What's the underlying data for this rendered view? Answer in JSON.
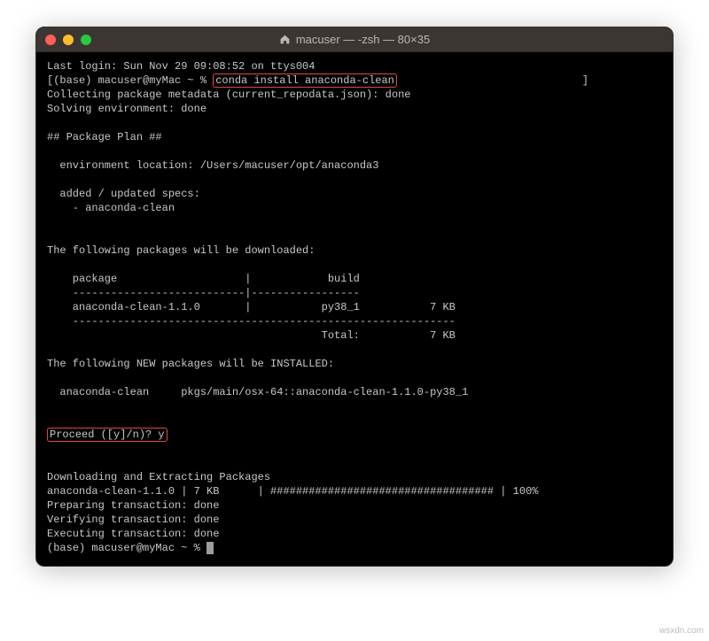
{
  "titlebar": {
    "title": "macuser — -zsh — 80×35"
  },
  "term": {
    "line_login": "Last login: Sun Nov 29 09:08:52 on ttys004",
    "prompt1_pre": "[(base) macuser@myMac ~ % ",
    "prompt1_cmd": "conda install anaconda-clean",
    "collecting": "Collecting package metadata (current_repodata.json): done",
    "solving": "Solving environment: done",
    "plan_hdr": "## Package Plan ##",
    "env_loc": "  environment location: /Users/macuser/opt/anaconda3",
    "added_specs": "  added / updated specs:",
    "spec_item": "    - anaconda-clean",
    "dl_hdr": "The following packages will be downloaded:",
    "tbl_hdr": "    package                    |            build",
    "tbl_sep1": "    ---------------------------|-----------------",
    "tbl_row": "    anaconda-clean-1.1.0       |           py38_1           7 KB",
    "tbl_sep2": "    ------------------------------------------------------------",
    "tbl_total": "                                           Total:           7 KB",
    "new_hdr": "The following NEW packages will be INSTALLED:",
    "new_row": "  anaconda-clean     pkgs/main/osx-64::anaconda-clean-1.1.0-py38_1",
    "proceed": "Proceed ([y]/n)? y",
    "dlext": "Downloading and Extracting Packages",
    "progress": "anaconda-clean-1.1.0 | 7 KB      | ################################### | 100%",
    "prep": "Preparing transaction: done",
    "verify": "Verifying transaction: done",
    "exec": "Executing transaction: done",
    "prompt2": "(base) macuser@myMac ~ % "
  },
  "watermark": "wsxdn.com"
}
